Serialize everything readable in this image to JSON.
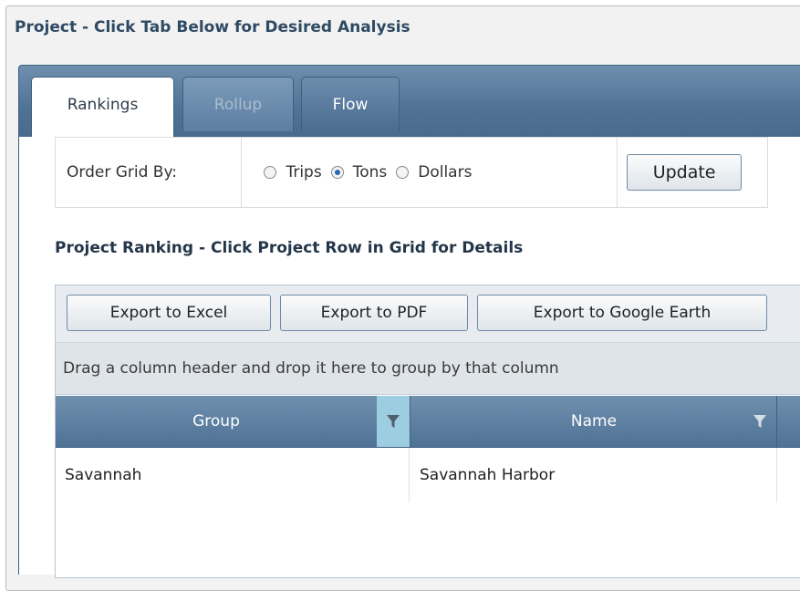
{
  "window": {
    "title": "Project - Click Tab Below for Desired Analysis"
  },
  "tabs": [
    {
      "label": "Rankings",
      "state": "active"
    },
    {
      "label": "Rollup",
      "state": "disabled"
    },
    {
      "label": "Flow",
      "state": "inactive"
    }
  ],
  "order": {
    "label": "Order Grid By:",
    "options": [
      {
        "label": "Trips",
        "selected": false
      },
      {
        "label": "Tons",
        "selected": true
      },
      {
        "label": "Dollars",
        "selected": false
      }
    ],
    "update_label": "Update"
  },
  "ranking": {
    "title": "Project Ranking - Click Project Row in Grid for Details"
  },
  "grid": {
    "toolbar": {
      "export_excel": "Export to Excel",
      "export_pdf": "Export to PDF",
      "export_google_earth": "Export to Google Earth"
    },
    "group_hint": "Drag a column header and drop it here to group by that column",
    "columns": [
      "Group",
      "Name"
    ],
    "rows": [
      {
        "group": "Savannah",
        "name": "Savannah Harbor"
      }
    ]
  },
  "colors": {
    "accent": "#4f7295",
    "title_text": "#2f4a63",
    "radio_selected": "#2c66b4"
  }
}
